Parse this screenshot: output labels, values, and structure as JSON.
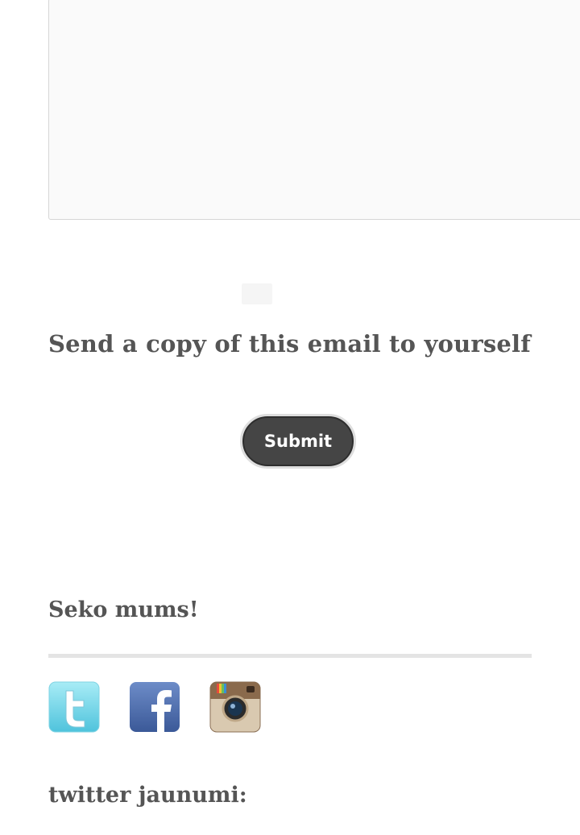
{
  "form": {
    "message_value": "",
    "copy_label_line": "Send a copy of this email to yourself",
    "submit_label": "Submit"
  },
  "widgets": {
    "follow_title": "Seko mums!",
    "social_icons": [
      "twitter-icon",
      "facebook-icon",
      "instagram-icon"
    ],
    "twitter_title": "twitter jaunumi:"
  },
  "colors": {
    "button_bg": "#454545",
    "text": "#555555",
    "divider": "#e4e4e4"
  }
}
